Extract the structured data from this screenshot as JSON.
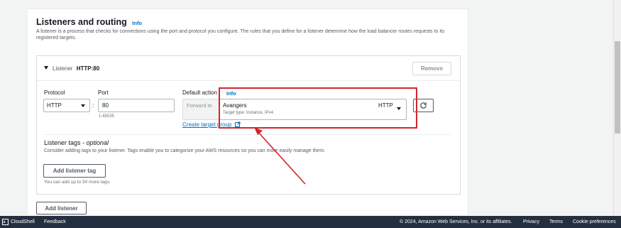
{
  "section": {
    "title": "Listeners and routing",
    "info": "Info",
    "description": "A listener is a process that checks for connections using the port and protocol you configure. The rules that you define for a listener determine how the load balancer routes requests to its registered targets."
  },
  "listener": {
    "prefix": "Listener",
    "name": "HTTP:80",
    "remove_label": "Remove",
    "protocol_label": "Protocol",
    "protocol_value": "HTTP",
    "colon": ":",
    "port_label": "Port",
    "port_value": "80",
    "port_hint": "1-65535",
    "default_action_label": "Default action",
    "default_action_info": "Info",
    "forward_to": "Forward to",
    "target_group_name": "Avangers",
    "target_group_protocol": "HTTP",
    "target_type": "Target type: Instance, IPv4",
    "create_target_group": "Create target group",
    "tags_title": "Listener tags",
    "tags_optional": " - optional",
    "tags_description": "Consider adding tags to your listener. Tags enable you to categorize your AWS resources so you can more easily manage them.",
    "add_tag_label": "Add listener tag",
    "tag_hint": "You can add up to 50 more tags."
  },
  "add_listener_label": "Add listener",
  "footer": {
    "cloudshell": "CloudShell",
    "feedback": "Feedback",
    "copyright": "© 2024, Amazon Web Services, Inc. or its affiliates.",
    "privacy": "Privacy",
    "terms": "Terms",
    "cookies": "Cookie preferences"
  },
  "colors": {
    "annotation": "#d1262d",
    "link": "#0073bb",
    "footer_bg": "#232f3e"
  }
}
